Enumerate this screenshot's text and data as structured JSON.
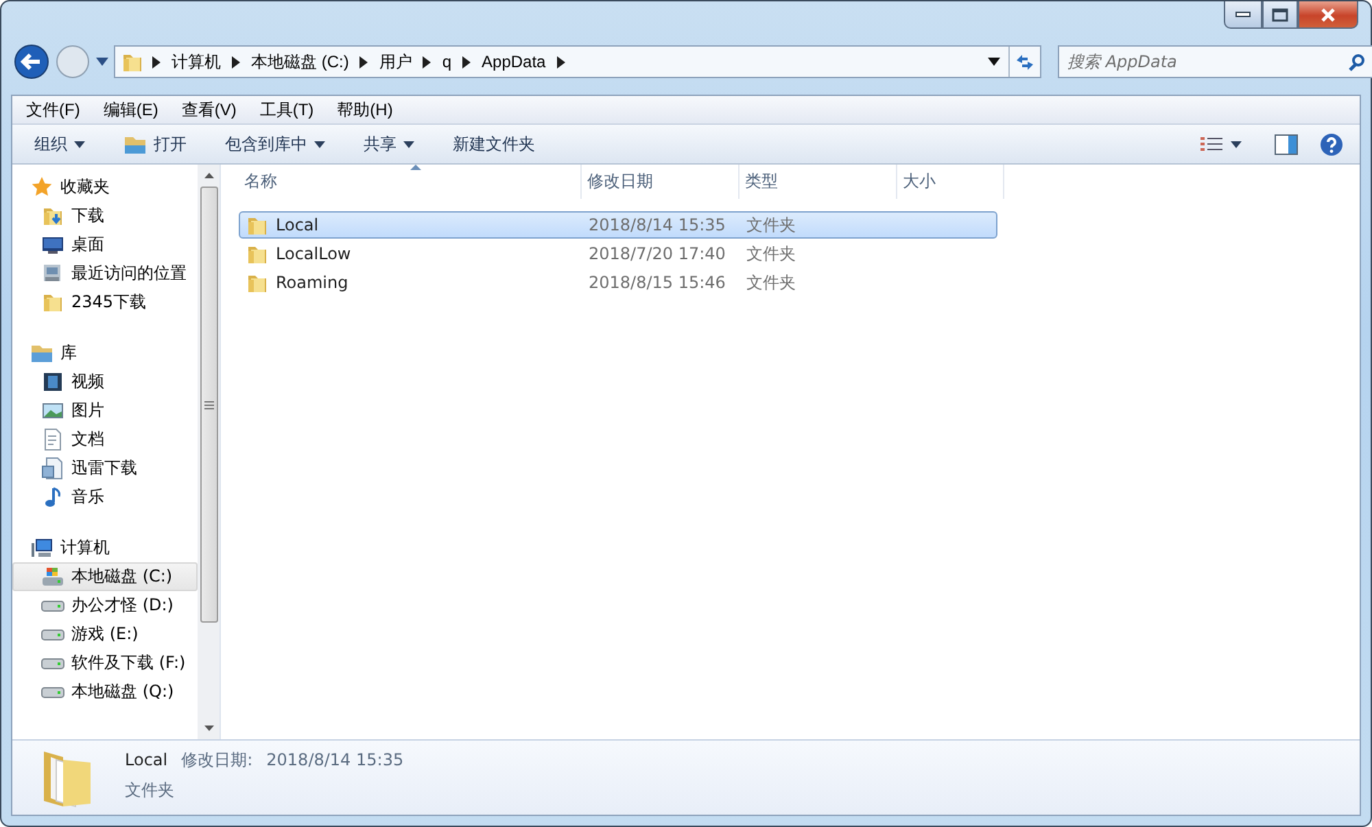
{
  "address": {
    "crumbs": [
      "计算机",
      "本地磁盘 (C:)",
      "用户",
      "q",
      "AppData"
    ]
  },
  "search": {
    "placeholder": "搜索 AppData"
  },
  "menu": [
    "文件(F)",
    "编辑(E)",
    "查看(V)",
    "工具(T)",
    "帮助(H)"
  ],
  "toolbar": [
    {
      "label": "组织",
      "kind": "dropdown"
    },
    {
      "label": "打开",
      "kind": "open"
    },
    {
      "label": "包含到库中",
      "kind": "dropdown"
    },
    {
      "label": "共享",
      "kind": "dropdown"
    },
    {
      "label": "新建文件夹",
      "kind": "plain"
    }
  ],
  "sidebar": {
    "sections": [
      {
        "label": "收藏夹",
        "kind": "star",
        "children": [
          {
            "label": "下载",
            "kind": "download",
            "selected": false
          },
          {
            "label": "桌面",
            "kind": "desktop",
            "selected": false
          },
          {
            "label": "最近访问的位置",
            "kind": "recent",
            "selected": false
          },
          {
            "label": "2345下载",
            "kind": "folder",
            "selected": false
          }
        ]
      },
      {
        "label": "库",
        "kind": "library",
        "children": [
          {
            "label": "视频",
            "kind": "video",
            "selected": false
          },
          {
            "label": "图片",
            "kind": "picture",
            "selected": false
          },
          {
            "label": "文档",
            "kind": "document",
            "selected": false
          },
          {
            "label": "迅雷下载",
            "kind": "document2",
            "selected": false
          },
          {
            "label": "音乐",
            "kind": "music",
            "selected": false
          }
        ]
      },
      {
        "label": "计算机",
        "kind": "computer",
        "children": [
          {
            "label": "本地磁盘 (C:)",
            "kind": "sysdrive",
            "selected": true
          },
          {
            "label": "办公才怪 (D:)",
            "kind": "drive",
            "selected": false
          },
          {
            "label": "游戏 (E:)",
            "kind": "drive",
            "selected": false
          },
          {
            "label": "软件及下载 (F:)",
            "kind": "drive",
            "selected": false
          },
          {
            "label": "本地磁盘 (Q:)",
            "kind": "drive",
            "selected": false
          }
        ]
      }
    ]
  },
  "table": {
    "columns": [
      {
        "label": "名称",
        "sorted": true
      },
      {
        "label": "修改日期",
        "sorted": false
      },
      {
        "label": "类型",
        "sorted": false
      },
      {
        "label": "大小",
        "sorted": false
      }
    ],
    "rows": [
      {
        "name": "Local",
        "modified": "2018/8/14 15:35",
        "type": "文件夹",
        "selected": true
      },
      {
        "name": "LocalLow",
        "modified": "2018/7/20 17:40",
        "type": "文件夹",
        "selected": false
      },
      {
        "name": "Roaming",
        "modified": "2018/8/15 15:46",
        "type": "文件夹",
        "selected": false
      }
    ]
  },
  "details": {
    "name": "Local",
    "date_label": "修改日期:",
    "date": "2018/8/14 15:35",
    "type": "文件夹"
  }
}
